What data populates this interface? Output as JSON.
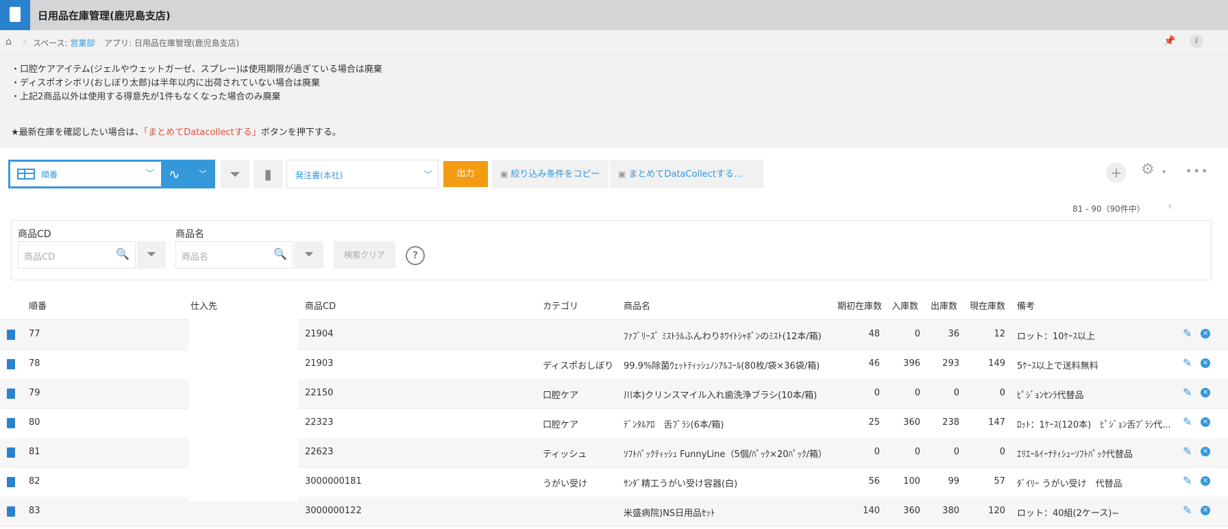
{
  "app": {
    "title": "日用品在庫管理(鹿児島支店)"
  },
  "breadcrumb": {
    "space_prefix": "スペース: ",
    "space_name": "営業部",
    "app_label": "アプリ: 日用品在庫管理(鹿児島支店)"
  },
  "description": {
    "lines": [
      "・口腔ケアアイテム(ジェルやウェットガーゼ、スプレー)は使用期限が過ぎている場合は廃棄",
      "・ディスポオシボリ(おしぼり太郎)は半年以内に出荷されていない場合は廃棄",
      "・上記2商品以外は使用する得意先が1件もなくなった場合のみ廃棄"
    ],
    "notice_prefix": "★最新在庫を確認したい場合は、",
    "notice_highlight": "「まとめてDatacollectする」",
    "notice_suffix": "ボタンを押下する。"
  },
  "toolbar": {
    "view_label": "順番",
    "filter_label": "発注書(本社)",
    "output_label": "出力",
    "copy_filter_label": "絞り込み条件をコピー",
    "datacollect_label": "まとめてDataCollectする..."
  },
  "pager": {
    "text": "81 - 90（90件中）"
  },
  "search": {
    "code_label": "商品CD",
    "code_placeholder": "商品CD",
    "name_label": "商品名",
    "name_placeholder": "商品名",
    "clear_label": "検索クリア",
    "help_label": "?"
  },
  "table": {
    "headers": [
      "順番",
      "仕入先",
      "商品CD",
      "カテゴリ",
      "商品名",
      "期初在庫数",
      "入庫数",
      "出庫数",
      "現在庫数",
      "備考"
    ],
    "rows": [
      [
        "77",
        "",
        "21904",
        "",
        "ﾌｧﾌﾞﾘｰｽﾞ ﾐｽﾄﾗﾙふんわりﾎﾜｲﾄｼｬﾎﾞﾝのﾐｽﾄ(12本/箱)",
        "48",
        "0",
        "36",
        "12",
        "ロット：10ｹｰｽ以上"
      ],
      [
        "78",
        "",
        "21903",
        "ディスポおしぼり",
        "99.9%除菌ｳｪｯﾄﾃｨｯｼｭﾉﾝｱﾙｺｰﾙ(80枚/袋×36袋/箱)",
        "46",
        "396",
        "293",
        "149",
        "5ｹｰｽ以上で送料無料"
      ],
      [
        "79",
        "",
        "22150",
        "口腔ケア",
        "川本)クリンスマイル入れ歯洗浄ブラシ(10本/箱)",
        "0",
        "0",
        "0",
        "0",
        "ﾋﾟｼﾞｮﾝｾﾝﾗ代替品"
      ],
      [
        "80",
        "",
        "22323",
        "口腔ケア",
        "ﾃﾞﾝﾀﾙｱﾛ　舌ﾌﾞﾗｼ(6本/箱)",
        "25",
        "360",
        "238",
        "147",
        "ﾛｯﾄ：1ｹｰｽ(120本)　ﾋﾟｼﾞｮﾝ舌ﾌﾞﾗｼ代..."
      ],
      [
        "81",
        "",
        "22623",
        "ティッシュ",
        "ｿﾌﾄﾊﾟｯｸﾃｨｯｼｭ FunnyLine（5個/ﾊﾟｯｸ×20ﾊﾟｯｸ/箱）",
        "0",
        "0",
        "0",
        "0",
        "ｴﾘｴｰﾙｲｰﾅﾃｨｼｭｰｿﾌﾄﾊﾟｯｸ代替品"
      ],
      [
        "82",
        "",
        "3000000181",
        "うがい受け",
        "ｻﾝﾀﾞ精工うがい受け容器(白)",
        "56",
        "100",
        "99",
        "57",
        "ﾀﾞｲﾘｰ うがい受け　代替品"
      ],
      [
        "83",
        "",
        "3000000122",
        "",
        "米盛病院)NS日用品ｾｯﾄ",
        "140",
        "360",
        "380",
        "120",
        "ロット：40組(2ケース)~"
      ]
    ]
  },
  "colors": {
    "accent": "#3498db",
    "output": "#f39c12",
    "notice_red": "#e74c3c"
  }
}
